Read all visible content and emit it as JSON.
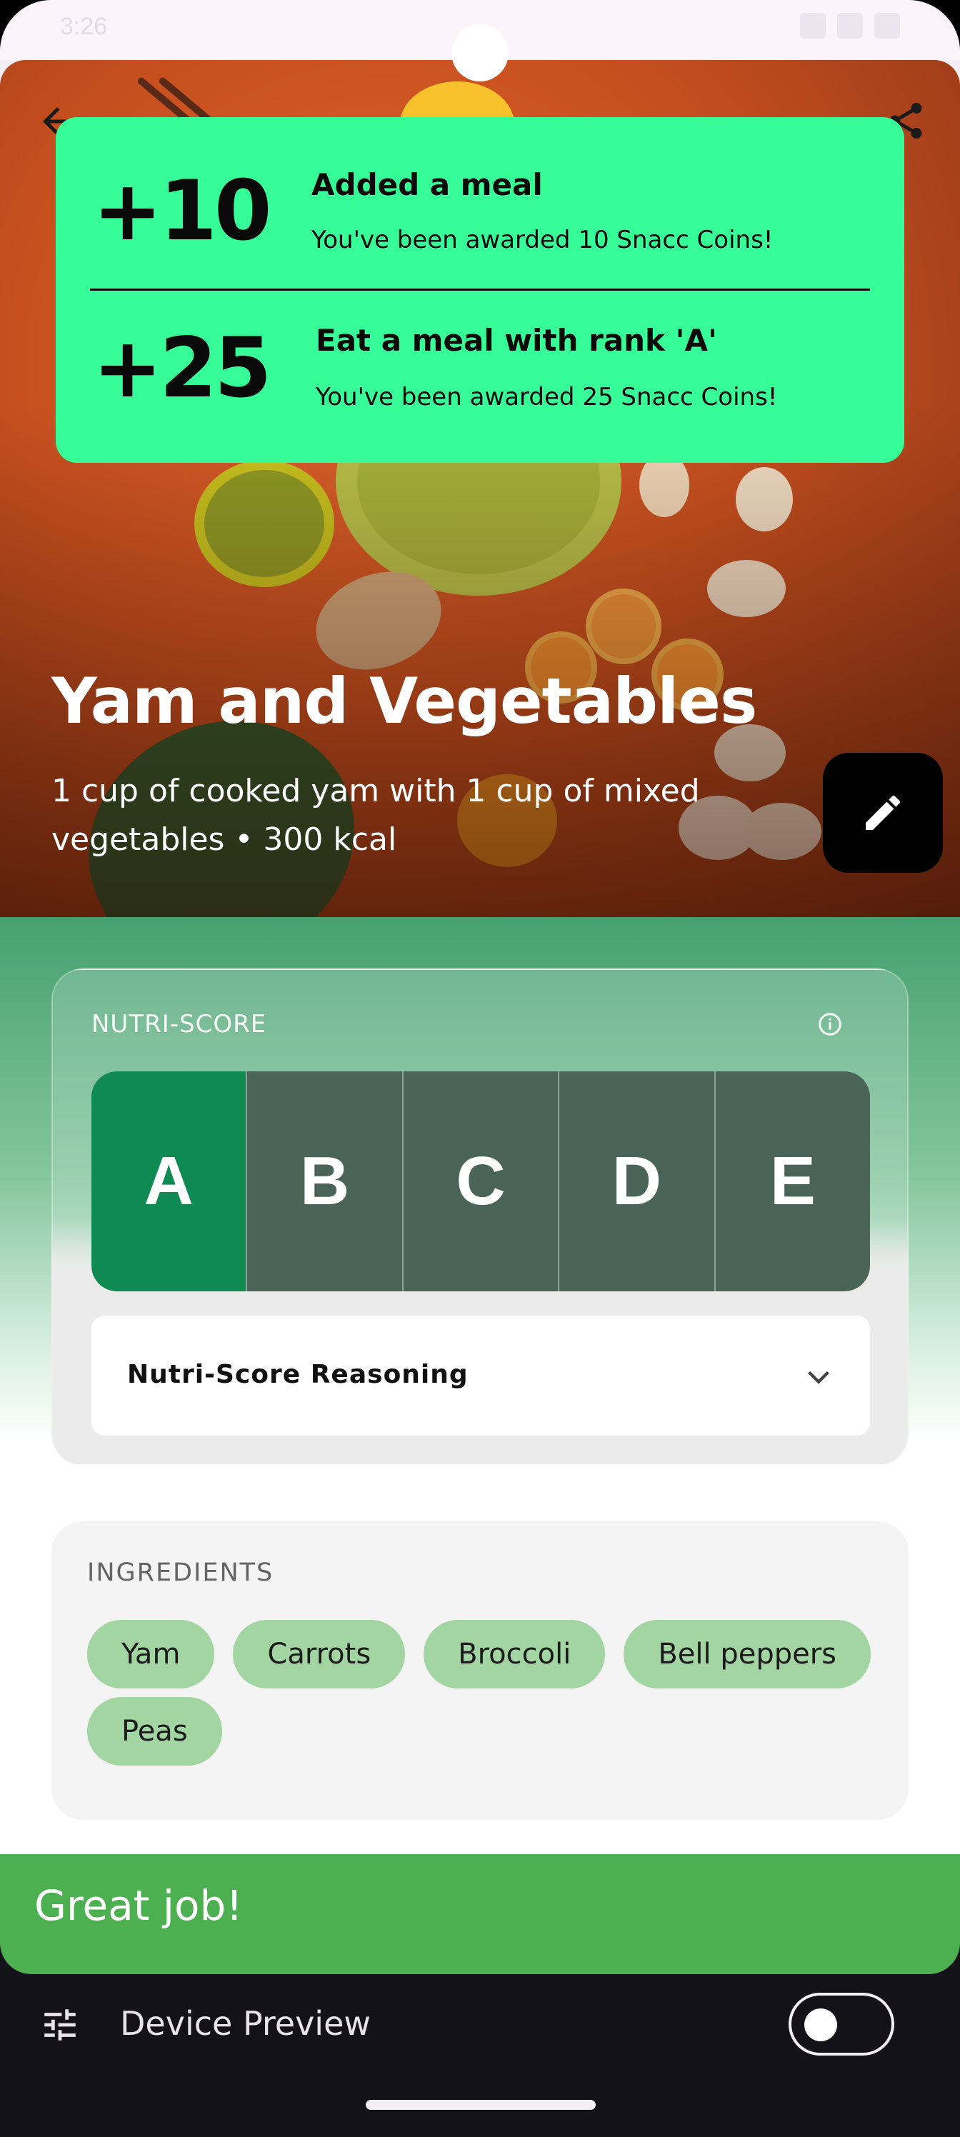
{
  "status_bar": {
    "time": "3:26"
  },
  "meal": {
    "title": "Yam and Vegetables",
    "description": "1 cup of cooked yam with 1 cup of mixed vegetables • 300 kcal"
  },
  "rewards": [
    {
      "amount": "+10",
      "title": "Added a meal",
      "subtitle": "You've been awarded 10 Snacc Coins!"
    },
    {
      "amount": "+25",
      "title": "Eat a meal with rank 'A'",
      "subtitle": "You've been awarded 25 Snacc Coins!"
    }
  ],
  "nutri_score": {
    "label": "NUTRI-SCORE",
    "grades": [
      "A",
      "B",
      "C",
      "D",
      "E"
    ],
    "selected": "A",
    "reasoning_label": "Nutri-Score Reasoning"
  },
  "ingredients": {
    "label": "INGREDIENTS",
    "items": [
      "Yam",
      "Carrots",
      "Broccoli",
      "Bell peppers",
      "Peas"
    ]
  },
  "bottom_banner": {
    "text": "Great job!"
  },
  "device_preview": {
    "label": "Device Preview",
    "enabled": false
  },
  "colors": {
    "popup": "#37fd98",
    "grade_active": "#0f8a52",
    "grade_inactive": "#4a6459",
    "chip": "#a3d5a2",
    "banner": "#4caf50"
  }
}
